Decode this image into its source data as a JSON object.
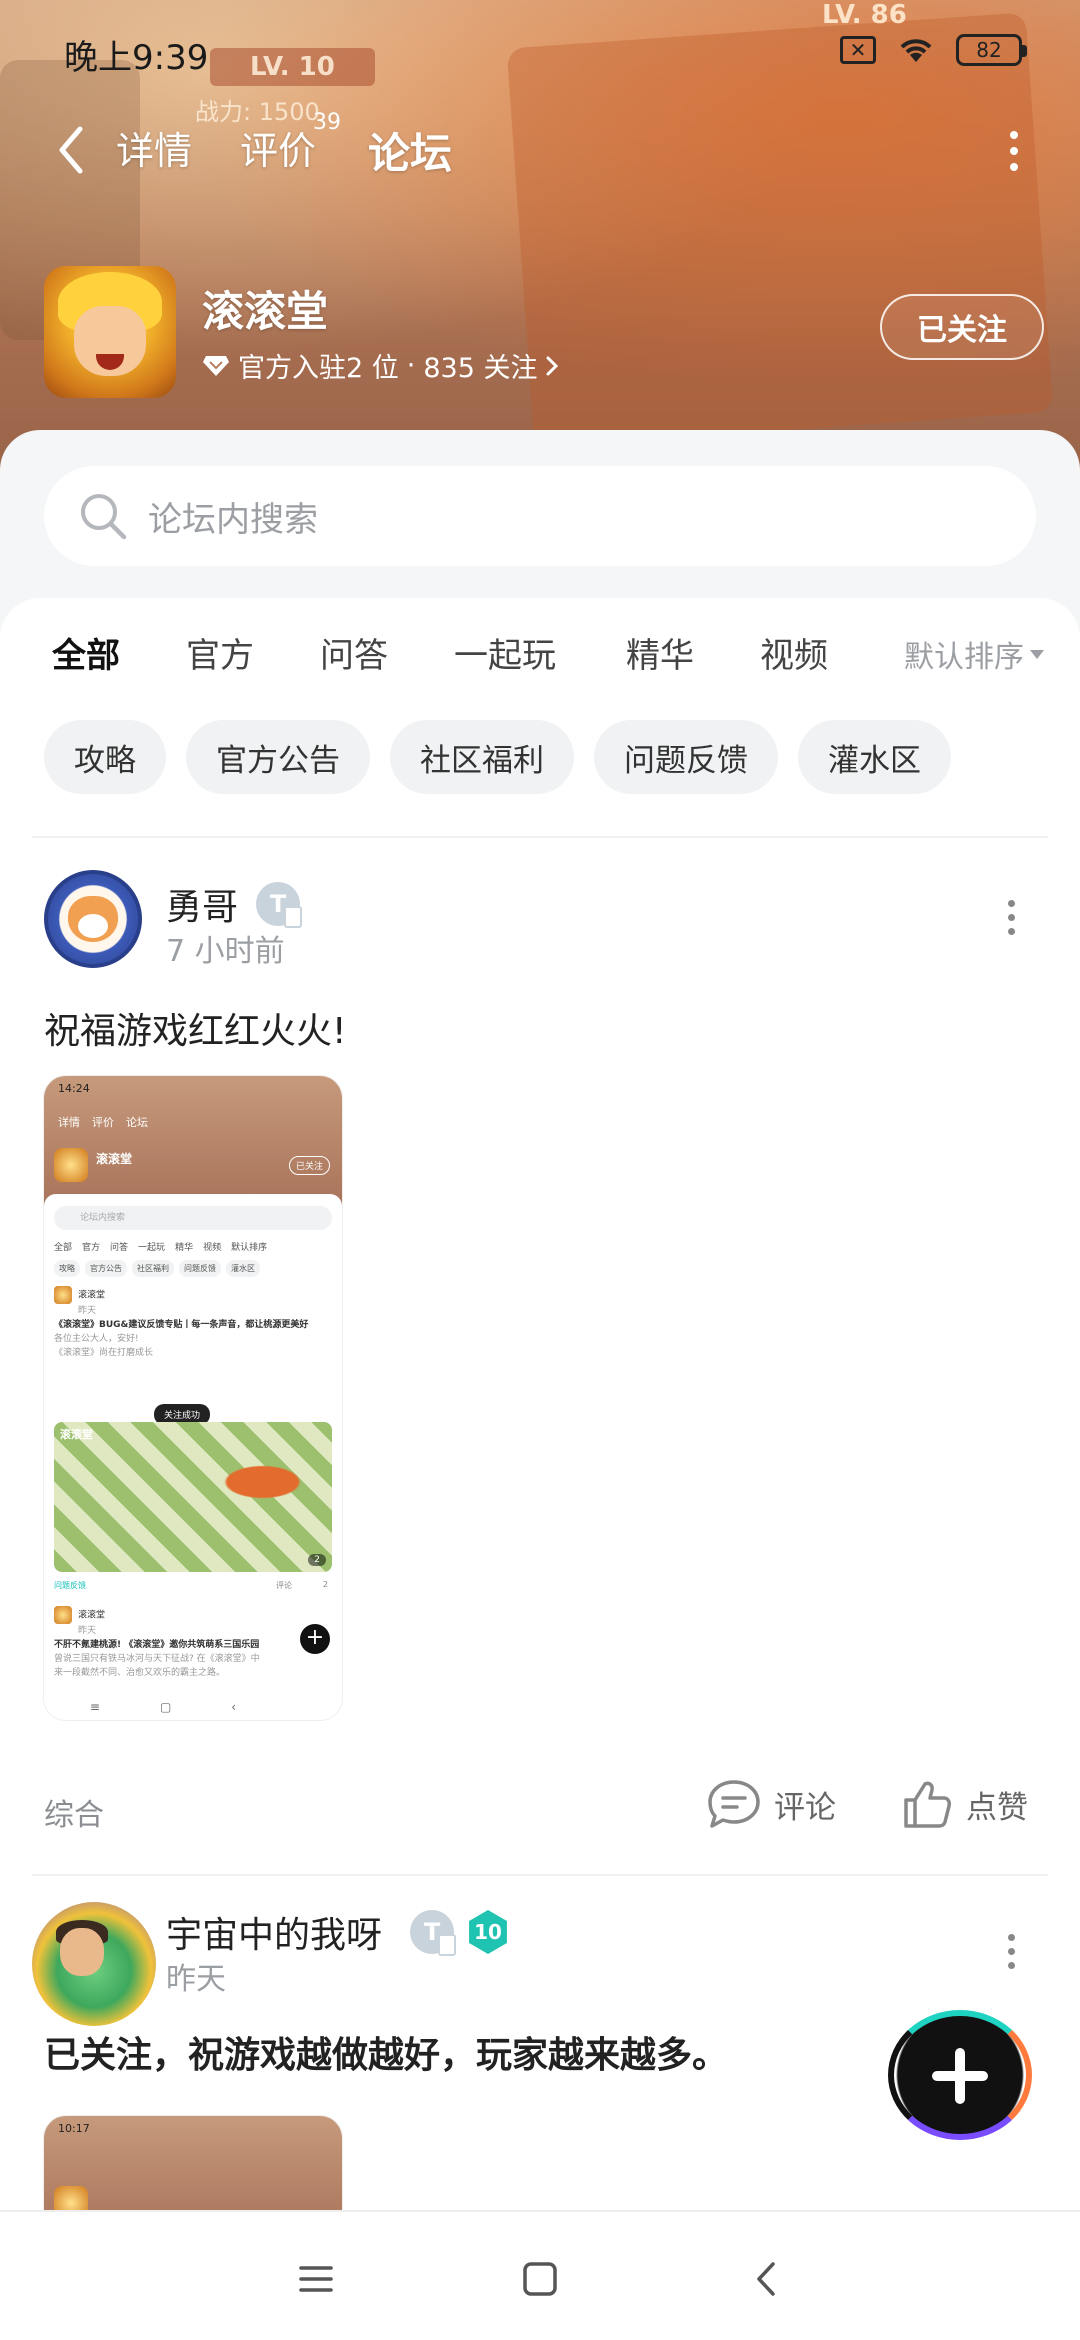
{
  "status_bar": {
    "time": "晚上9:39",
    "battery": "82",
    "sim_icon": "x-box-icon",
    "wifi_icon": "wifi-icon"
  },
  "hero_art": {
    "level_left": "LV. 10",
    "power_text": "战力: 1500",
    "level_right": "LV. 86"
  },
  "top_tabs": {
    "details": "详情",
    "reviews": "评价",
    "reviews_count": "39",
    "forum": "论坛",
    "active": "论坛"
  },
  "game": {
    "name": "滚滚堂",
    "official_count_text": "官方入驻2 位",
    "separator": "·",
    "follow_count_text": "835 关注",
    "follow_button": "已关注"
  },
  "search": {
    "placeholder": "论坛内搜索"
  },
  "categories": {
    "tabs": [
      "全部",
      "官方",
      "问答",
      "一起玩",
      "精华",
      "视频"
    ],
    "active": "全部",
    "sort_label": "默认排序"
  },
  "chips": [
    "攻略",
    "官方公告",
    "社区福利",
    "问题反馈",
    "灌水区"
  ],
  "posts": [
    {
      "author": "勇哥",
      "time": "7 小时前",
      "text": "祝福游戏红红火火!",
      "tag": "综合",
      "comment_label": "评论",
      "like_label": "点赞",
      "thumb": {
        "time": "14:24",
        "tabs": [
          "详情",
          "评价",
          "论坛"
        ],
        "game_name": "滚滚堂",
        "follow": "已关注",
        "search": "论坛内搜索",
        "cats": [
          "全部",
          "官方",
          "问答",
          "一起玩",
          "精华",
          "视频",
          "默认排序"
        ],
        "chips": [
          "攻略",
          "官方公告",
          "社区福利",
          "问题反馈",
          "灌水区"
        ],
        "p1_author": "滚滚堂",
        "p1_time": "昨天",
        "p1_title": "《滚滚堂》BUG&建议反馈专贴丨每一条声音，都让桃源更美好",
        "p1_line1": "各位主公大人，安好!",
        "p1_line2": "《滚滚堂》尚在打磨成长",
        "toast": "关注成功",
        "img_label": "滚滚堂",
        "img_count": "2",
        "p1_tag": "问题反馈",
        "p1_comment": "评论",
        "p1_likes": "2",
        "p2_author": "滚滚堂",
        "p2_time": "昨天",
        "p2_title": "不肝不氪建桃源! 《滚滚堂》邀你共筑萌系三国乐园",
        "p2_line1": "曾说三国只有铁马冰河与天下征战? 在《滚滚堂》中",
        "p2_line2": "来一段截然不同、治愈又欢乐的霸主之路。"
      }
    },
    {
      "author": "宇宙中的我呀",
      "time": "昨天",
      "level_badge": "10",
      "text": "已关注，祝游戏越做越好，玩家越来越多。",
      "thumb_time": "10:17"
    }
  ],
  "icons": {
    "back": "back-arrow-icon",
    "more": "more-vertical-icon",
    "search": "search-icon",
    "diamond": "diamond-icon",
    "comment": "comment-icon",
    "like": "thumbs-up-icon",
    "fab": "plus-icon"
  },
  "colors": {
    "accent": "#16c2b7",
    "text_primary": "#222222",
    "text_secondary": "#9b9ea3"
  }
}
